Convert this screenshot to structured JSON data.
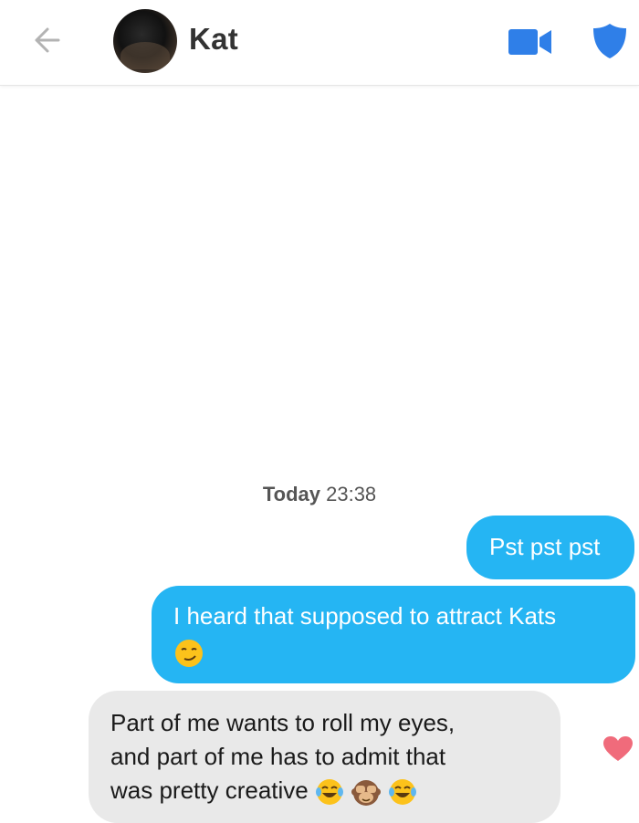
{
  "header": {
    "contact_name": "Kat",
    "icons": {
      "back": "back-arrow-icon",
      "video": "video-camera-icon",
      "safety": "shield-icon"
    },
    "colors": {
      "accent": "#2f7fe8",
      "back": "#b3b3b3"
    }
  },
  "conversation": {
    "timestamp_day": "Today",
    "timestamp_time": "23:38",
    "messages": [
      {
        "direction": "outgoing",
        "text": "Pst pst pst"
      },
      {
        "direction": "outgoing",
        "text": "I heard that supposed to attract Kats",
        "emojis": [
          "smirk-face-emoji"
        ]
      },
      {
        "direction": "incoming",
        "line1": "Part of me wants to roll my eyes,",
        "line2": "and part of me has to admit that",
        "line3": "was pretty creative",
        "emojis": [
          "tears-of-joy-emoji",
          "see-no-evil-monkey-emoji",
          "tears-of-joy-emoji"
        ]
      }
    ],
    "colors": {
      "outgoing_bubble": "#25b5f3",
      "incoming_bubble": "#e9e9e9",
      "like_heart": "#f06b7b"
    }
  }
}
